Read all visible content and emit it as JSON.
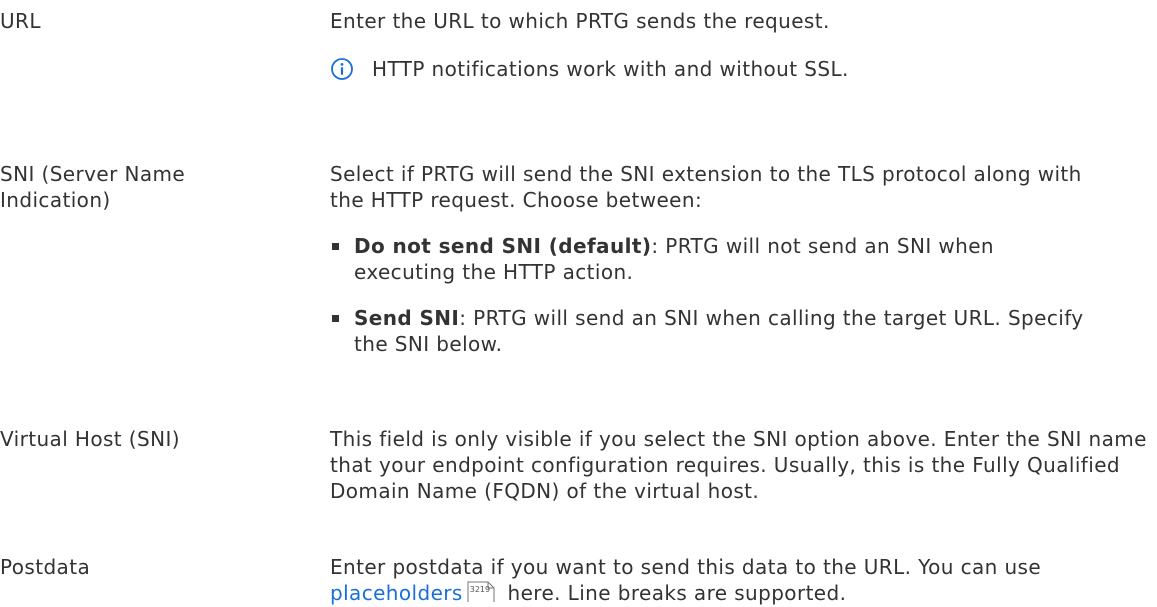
{
  "rows": [
    {
      "label": "URL",
      "description": "Enter the URL to which PRTG sends the request.",
      "note": "HTTP notifications work with and without SSL."
    },
    {
      "label": "SNI (Server Name Indication)",
      "description": "Select if PRTG will send the SNI extension to the TLS protocol along with the HTTP request. Choose between:",
      "options": [
        {
          "name": "Do not send SNI (default)",
          "text": ": PRTG will not send an SNI when executing the HTTP action."
        },
        {
          "name": "Send SNI",
          "text": ": PRTG will send an SNI when calling the target URL. Specify the SNI below."
        }
      ]
    },
    {
      "label": "Virtual Host (SNI)",
      "description": "This field is only visible if you select the SNI option above. Enter the SNI name that your endpoint configuration requires. Usually, this is the Fully Qualified Domain Name (FQDN) of the virtual host."
    },
    {
      "label": "Postdata",
      "description_before": "Enter postdata if you want to send this data to the URL. You can use",
      "link_text": "placeholders",
      "page_ref": "3219",
      "description_after": "here. Line breaks are supported."
    }
  ],
  "colors": {
    "text": "#333333",
    "link": "#1a6fd8",
    "icon": "#1a6fd8"
  },
  "icons": {
    "note": "info-icon",
    "page_ref": "page-reference-icon"
  }
}
